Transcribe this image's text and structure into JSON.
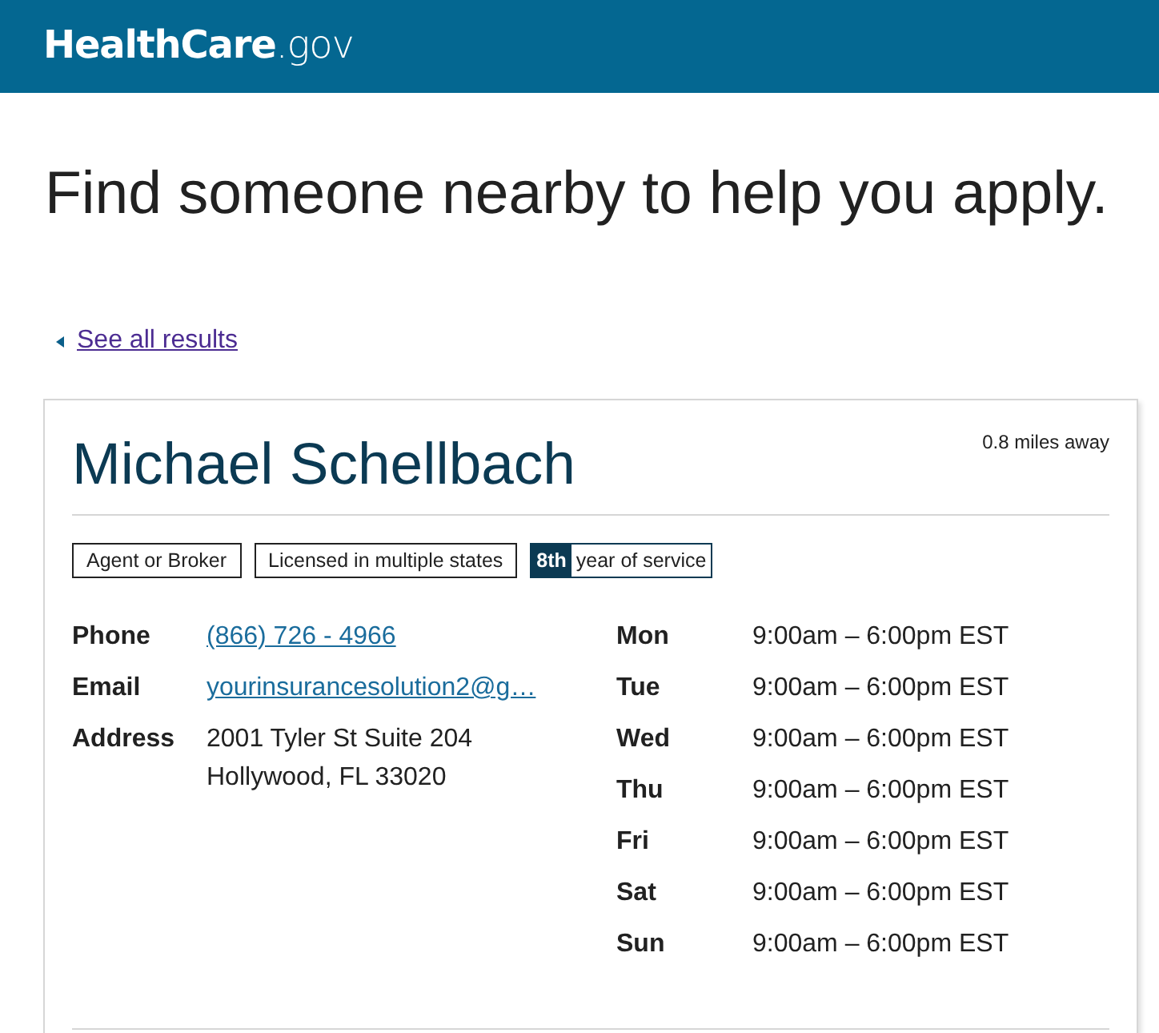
{
  "header": {
    "logo": "**HealthCare**.gov"
  },
  "page": {
    "title": "Find someone nearby to help you apply.",
    "back_link": "See all results"
  },
  "card": {
    "name": "Michael Schellbach",
    "distance": "0.8 miles away",
    "tags": [
      {
        "kind": "plain",
        "label": "Agent or Broker"
      },
      {
        "kind": "plain",
        "label": "Licensed in multiple states"
      },
      {
        "kind": "ordinal",
        "highlight": "8th",
        "label": "year of service"
      }
    ],
    "details": [
      {
        "kind": "link",
        "label": "Phone",
        "value": "(866) 726 - 4966"
      },
      {
        "kind": "link",
        "label": "Email",
        "value": "yourinsurancesolution2@g…"
      },
      {
        "kind": "text",
        "label": "Address",
        "lines": [
          "2001 Tyler St Suite 204",
          "Hollywood, FL 33020"
        ]
      }
    ],
    "hours": [
      {
        "day": "Mon",
        "time": "9:00am – 6:00pm EST"
      },
      {
        "day": "Tue",
        "time": "9:00am – 6:00pm EST"
      },
      {
        "day": "Wed",
        "time": "9:00am – 6:00pm EST"
      },
      {
        "day": "Thu",
        "time": "9:00am – 6:00pm EST"
      },
      {
        "day": "Fri",
        "time": "9:00am – 6:00pm EST"
      },
      {
        "day": "Sat",
        "time": "9:00am – 6:00pm EST"
      },
      {
        "day": "Sun",
        "time": "9:00am – 6:00pm EST"
      }
    ]
  }
}
